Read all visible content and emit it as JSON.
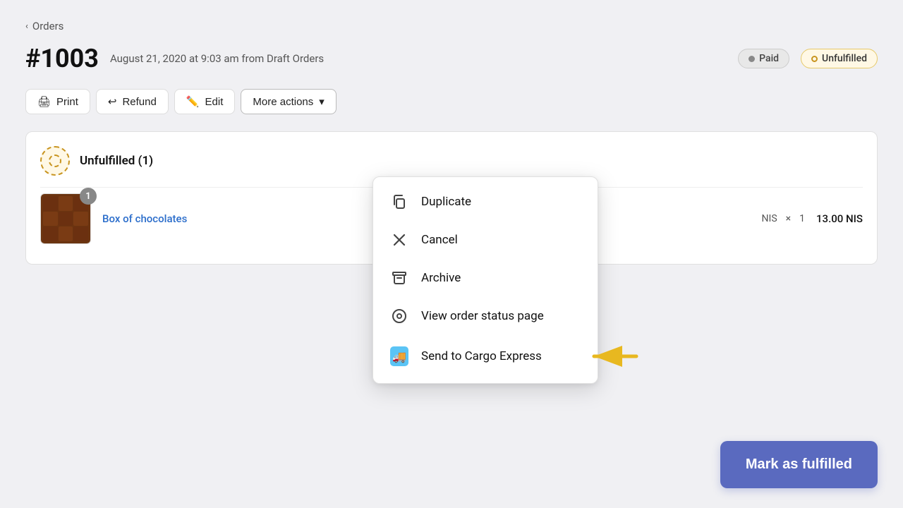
{
  "breadcrumb": {
    "label": "Orders"
  },
  "order": {
    "number": "#1003",
    "meta": "August 21, 2020 at 9:03 am from Draft Orders",
    "paid_badge": "Paid",
    "unfulfilled_badge": "Unfulfilled"
  },
  "toolbar": {
    "print": "Print",
    "refund": "Refund",
    "edit": "Edit",
    "more_actions": "More actions"
  },
  "card": {
    "status_title": "Unfulfilled (1)",
    "product_name": "Box of chocolates",
    "quantity_badge": "1",
    "price_info": "NIS",
    "price_multiply": "×",
    "price_qty": "1",
    "price_total": "13.00 NIS"
  },
  "dropdown": {
    "items": [
      {
        "id": "duplicate",
        "label": "Duplicate",
        "icon": "duplicate"
      },
      {
        "id": "cancel",
        "label": "Cancel",
        "icon": "cancel"
      },
      {
        "id": "archive",
        "label": "Archive",
        "icon": "archive"
      },
      {
        "id": "view-status",
        "label": "View order status page",
        "icon": "view"
      },
      {
        "id": "cargo",
        "label": "Send to Cargo Express",
        "icon": "cargo"
      }
    ]
  },
  "mark_fulfilled": "Mark as fulfilled"
}
